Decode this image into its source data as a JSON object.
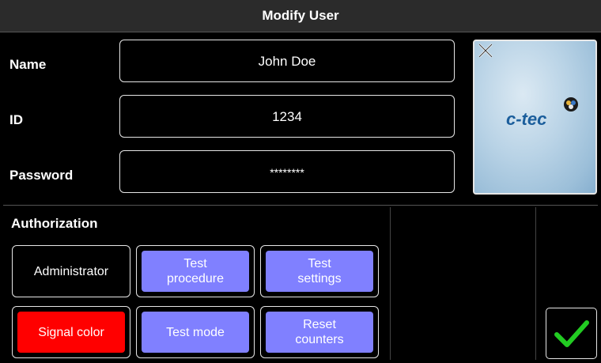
{
  "window": {
    "title": "Modify User"
  },
  "form": {
    "name": {
      "label": "Name",
      "value": "John Doe"
    },
    "id": {
      "label": "ID",
      "value": "1234"
    },
    "password": {
      "label": "Password",
      "value": "********"
    }
  },
  "logo": {
    "brand": "c-tec",
    "close_icon": "close-icon"
  },
  "authorization": {
    "label": "Authorization",
    "buttons": [
      {
        "label": "Administrator",
        "state": "off",
        "color": "#000000"
      },
      {
        "label": "Test\nprocedure",
        "state": "on",
        "color": "#8080ff"
      },
      {
        "label": "Test\nsettings",
        "state": "on",
        "color": "#8080ff"
      },
      {
        "label": "Signal color",
        "state": "special",
        "color": "#ff0000"
      },
      {
        "label": "Test mode",
        "state": "on",
        "color": "#8080ff"
      },
      {
        "label": "Reset\ncounters",
        "state": "on",
        "color": "#8080ff"
      }
    ]
  },
  "confirm": {
    "icon": "checkmark-icon",
    "color": "#22cc22"
  }
}
